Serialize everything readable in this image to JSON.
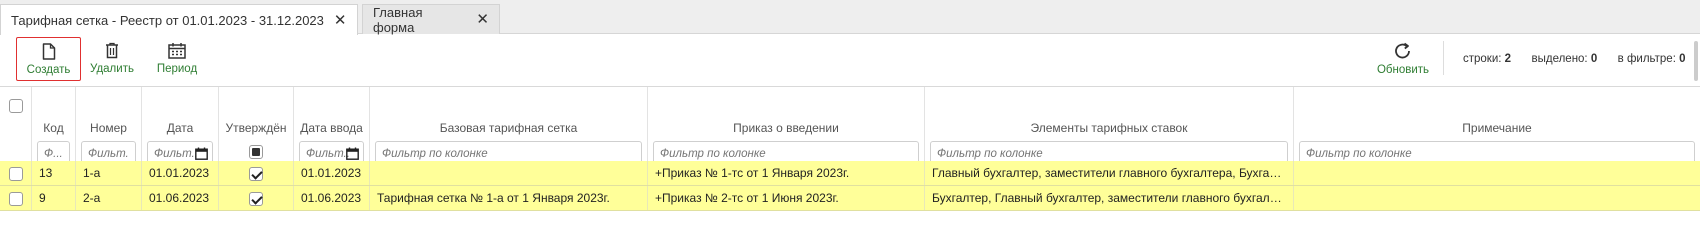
{
  "tabs": [
    {
      "label": "Тарифная сетка - Реестр от 01.01.2023 - 31.12.2023",
      "active": true
    },
    {
      "label": "Главная форма",
      "active": false
    }
  ],
  "toolbar": {
    "create_label": "Создать",
    "delete_label": "Удалить",
    "period_label": "Период",
    "refresh_label": "Обновить"
  },
  "stats": {
    "rows_label": "строки:",
    "rows_value": "2",
    "selected_label": "выделено:",
    "selected_value": "0",
    "filtered_label": "в фильтре:",
    "filtered_value": "0"
  },
  "columns": {
    "kod": {
      "title": "Код",
      "filter_placeholder": "Ф..."
    },
    "nomer": {
      "title": "Номер",
      "filter_placeholder": "Фильт..."
    },
    "data": {
      "title": "Дата",
      "filter_placeholder": "Фильт..."
    },
    "utverzhden": {
      "title": "Утверждён"
    },
    "data_vvoda": {
      "title": "Дата ввода",
      "filter_placeholder": "Фильт..."
    },
    "bazovaya": {
      "title": "Базовая тарифная сетка",
      "filter_placeholder": "Фильтр по колонке"
    },
    "prikaz": {
      "title": "Приказ о введении",
      "filter_placeholder": "Фильтр по колонке"
    },
    "elementy": {
      "title": "Элементы тарифных ставок",
      "filter_placeholder": "Фильтр по колонке"
    },
    "primechanie": {
      "title": "Примечание",
      "filter_placeholder": "Фильтр по колонке"
    }
  },
  "rows": [
    {
      "kod": "13",
      "nomer": "1-а",
      "data": "01.01.2023",
      "utverzhden": true,
      "data_vvoda": "01.01.2023",
      "bazovaya": "",
      "prikaz": "+Приказ № 1-тс от 1 Января 2023г.",
      "elementy": "Главный бухгалтер, заместители главного бухгалтера, Бухгалтер",
      "primechanie": ""
    },
    {
      "kod": "9",
      "nomer": "2-а",
      "data": "01.06.2023",
      "utverzhden": true,
      "data_vvoda": "01.06.2023",
      "bazovaya": "Тарифная сетка № 1-а от 1 Января 2023г.",
      "prikaz": "+Приказ № 2-тс от 1 Июня 2023г.",
      "elementy": "Бухгалтер, Главный бухгалтер, заместители главного бухгалтера",
      "primechanie": ""
    }
  ],
  "colors": {
    "accent_green": "#2e7d32",
    "row_highlight": "#ffff99",
    "create_border": "#e03030"
  },
  "icons": [
    "file-icon",
    "trash-icon",
    "calendar-icon",
    "refresh-icon",
    "close-icon",
    "checkbox-icon"
  ]
}
